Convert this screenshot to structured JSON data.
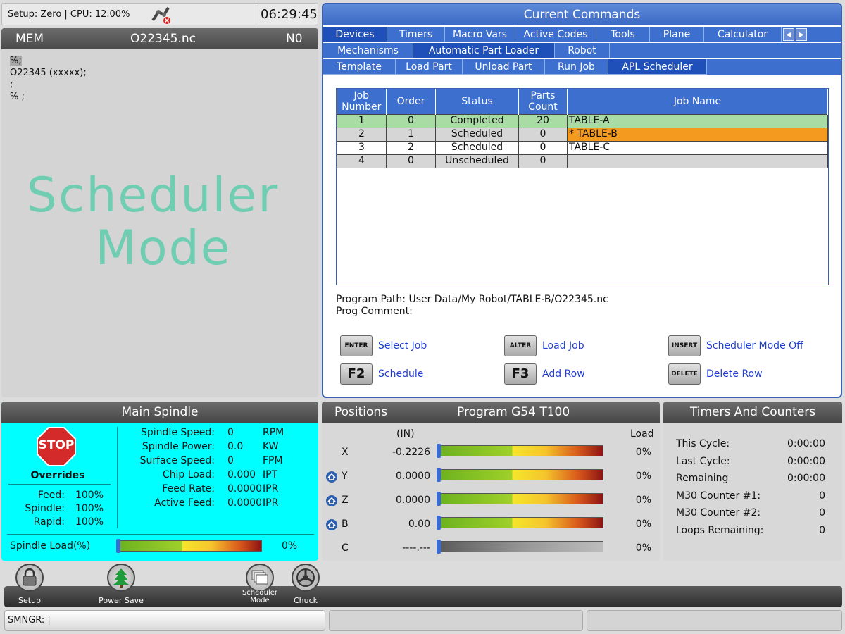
{
  "status": {
    "setup_text": "Setup: Zero | CPU: 12.00%",
    "clock": "06:29:45"
  },
  "program": {
    "mode": "MEM",
    "file": "O22345.nc",
    "n_line": "N0",
    "lines": [
      "%;",
      "O22345 (xxxxx);",
      ";",
      "% ;"
    ],
    "overlay_line1": "Scheduler",
    "overlay_line2": "Mode"
  },
  "commands": {
    "title": "Current Commands",
    "tabs_row1": [
      "Devices",
      "Timers",
      "Macro Vars",
      "Active Codes",
      "Tools",
      "Plane",
      "Calculator"
    ],
    "tabs_row2": [
      "Mechanisms",
      "Automatic Part Loader",
      "Robot"
    ],
    "tabs_row3": [
      "Template",
      "Load Part",
      "Unload Part",
      "Run Job",
      "APL Scheduler"
    ],
    "arrows": [
      "◀",
      "▶"
    ],
    "table": {
      "headers": [
        "Job\nNumber",
        "Order",
        "Status",
        "Parts\nCount",
        "Job Name"
      ],
      "rows": [
        {
          "job": "1",
          "order": "0",
          "status": "Completed",
          "parts": "20",
          "name": "TABLE-A"
        },
        {
          "job": "2",
          "order": "1",
          "status": "Scheduled",
          "parts": "0",
          "name": "* TABLE-B"
        },
        {
          "job": "3",
          "order": "2",
          "status": "Scheduled",
          "parts": "0",
          "name": "TABLE-C"
        },
        {
          "job": "4",
          "order": "0",
          "status": "Unscheduled",
          "parts": "0",
          "name": ""
        }
      ]
    },
    "program_path": "Program Path: User Data/My Robot/TABLE-B/O22345.nc",
    "prog_comment": "Prog Comment:",
    "keys": [
      {
        "key": "ENTER",
        "label": "Select Job"
      },
      {
        "key": "ALTER",
        "label": "Load Job"
      },
      {
        "key": "INSERT",
        "label": "Scheduler Mode Off"
      },
      {
        "key": "F2",
        "label": "Schedule"
      },
      {
        "key": "F3",
        "label": "Add Row"
      },
      {
        "key": "DELETE",
        "label": "Delete Row"
      }
    ]
  },
  "spindle": {
    "title": "Main Spindle",
    "stop": "STOP",
    "overrides_label": "Overrides",
    "overrides": [
      {
        "k": "Feed:",
        "v": "100%"
      },
      {
        "k": "Spindle:",
        "v": "100%"
      },
      {
        "k": "Rapid:",
        "v": "100%"
      }
    ],
    "readouts": [
      {
        "k": "Spindle Speed:",
        "v": "0",
        "u": "RPM"
      },
      {
        "k": "Spindle Power:",
        "v": "0.0",
        "u": "KW"
      },
      {
        "k": "Surface Speed:",
        "v": "0",
        "u": "FPM"
      },
      {
        "k": "Chip Load:",
        "v": "0.000",
        "u": "IPT"
      },
      {
        "k": "Feed Rate:",
        "v": "0.0000",
        "u": "IPR"
      },
      {
        "k": "Active Feed:",
        "v": "0.0000",
        "u": "IPR"
      }
    ],
    "load_label": "Spindle Load(%)",
    "load_value": "0%",
    "load_fraction": 0
  },
  "positions": {
    "title": "Positions",
    "subtitle": "Program G54 T100",
    "units": "(IN)",
    "load_header": "Load",
    "axes": [
      {
        "axis": "X",
        "value": "-0.2226",
        "load": "0%",
        "homed": false,
        "active": true
      },
      {
        "axis": "Y",
        "value": "0.0000",
        "load": "0%",
        "homed": true,
        "active": true
      },
      {
        "axis": "Z",
        "value": "0.0000",
        "load": "0%",
        "homed": true,
        "active": true
      },
      {
        "axis": "B",
        "value": "0.00",
        "load": "0%",
        "homed": true,
        "active": true
      },
      {
        "axis": "C",
        "value": "----.---",
        "load": "0%",
        "homed": false,
        "active": false
      }
    ]
  },
  "timers": {
    "title": "Timers And Counters",
    "rows": [
      {
        "k": "This Cycle:",
        "v": "0:00:00"
      },
      {
        "k": "Last Cycle:",
        "v": "0:00:00"
      },
      {
        "k": "Remaining",
        "v": "0:00:00"
      },
      {
        "k": "M30 Counter #1:",
        "v": "0"
      },
      {
        "k": "M30 Counter #2:",
        "v": "0"
      },
      {
        "k": "Loops Remaining:",
        "v": "0"
      }
    ]
  },
  "bottom": {
    "icons": [
      {
        "label": "Setup",
        "icon": "lock-icon"
      },
      {
        "label": "Power Save",
        "icon": "tree-icon"
      },
      {
        "label": "Scheduler\nMode",
        "icon": "scheduler-icon"
      },
      {
        "label": "Chuck",
        "icon": "chuck-icon"
      }
    ],
    "cmdline": "SMNGR: |"
  },
  "colors": {
    "accent": "#3d6fcf",
    "completed": "#a9dba4",
    "selected": "#f49a1e",
    "spindle_bg": "#00ffff",
    "overlay": "#6fcdb1"
  }
}
